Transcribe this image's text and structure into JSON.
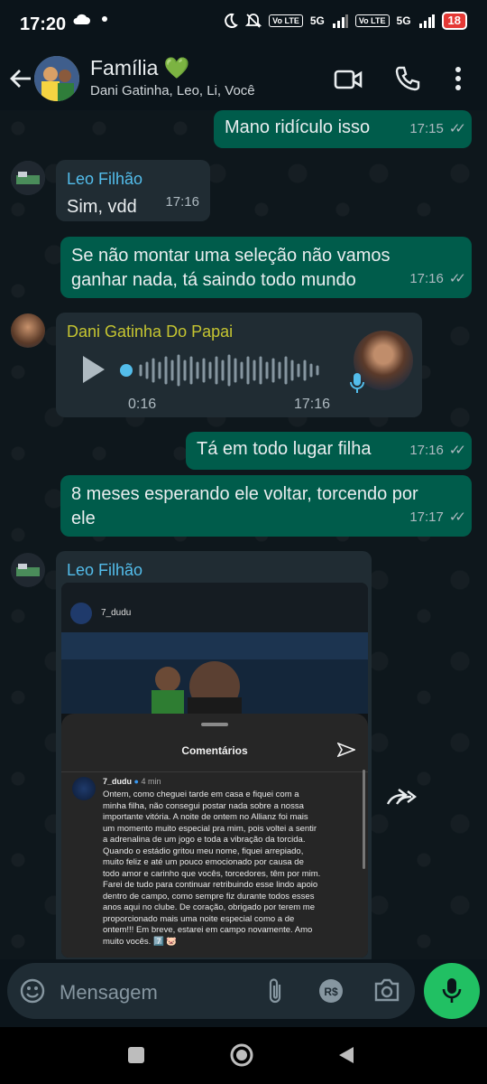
{
  "status": {
    "time": "17:20",
    "network1": "5G",
    "network2": "5G",
    "volte1": "Vo LTE",
    "volte2": "Vo LTE",
    "battery": "18"
  },
  "header": {
    "title": "Família",
    "heart": "💚",
    "members": "Dani Gatinha, Leo, Li, Você"
  },
  "messages": {
    "m1": {
      "text": "Mano ridículo isso",
      "time": "17:15"
    },
    "m2": {
      "sender": "Leo Filhão",
      "text": "Sim, vdd",
      "time": "17:16"
    },
    "m3": {
      "line1": "Se não montar uma seleção não vamos",
      "line2": "ganhar nada, tá saindo todo mundo",
      "time": "17:16"
    },
    "m4": {
      "sender": "Dani Gatinha Do Papai",
      "duration": "0:16",
      "time": "17:16"
    },
    "m5": {
      "text": "Tá em todo lugar filha",
      "time": "17:16"
    },
    "m6": {
      "line1": "8 meses esperando ele voltar, torcendo por",
      "line2": "ele",
      "time": "17:17"
    },
    "m7": {
      "sender": "Leo Filhão"
    }
  },
  "instagram": {
    "username": "7_dudu",
    "sheet_title": "Comentários",
    "comment_user": "7_dudu",
    "comment_age": "4 min",
    "comment_lines": [
      "Ontem, como cheguei tarde em casa e fiquei com a",
      "minha filha, não consegui postar nada sobre a nossa",
      "importante vitória. A noite de ontem no Allianz foi mais",
      "um momento muito especial pra mim, pois voltei a sentir",
      "a adrenalina de um jogo e toda a vibração da torcida.",
      "Quando o estádio gritou meu nome, fiquei arrepiado,",
      "muito feliz e até um pouco emocionado por causa de",
      "todo amor e carinho que vocês, torcedores, têm por mim.",
      "Farei de tudo para continuar retribuindo esse lindo apoio",
      "dentro de campo, como sempre fiz durante todos esses",
      "anos aqui no clube. De coração, obrigado por terem me",
      "proporcionado mais uma noite especial como a de",
      "ontem!!! Em breve, estarei em campo novamente. Amo",
      "muito vocês. 7️⃣ 🐷"
    ]
  },
  "composer": {
    "placeholder": "Mensagem"
  },
  "colors": {
    "outgoing": "#005c4b",
    "incoming": "#202c33",
    "accent": "#21c063",
    "sender_leo": "#53bdeb",
    "sender_dani": "#c5c531"
  },
  "icons": [
    "back-arrow-icon",
    "video-call-icon",
    "phone-icon",
    "more-icon",
    "play-icon",
    "mic-icon",
    "forward-icon",
    "emoji-icon",
    "attach-icon",
    "payment-icon",
    "camera-icon",
    "send-icon"
  ]
}
